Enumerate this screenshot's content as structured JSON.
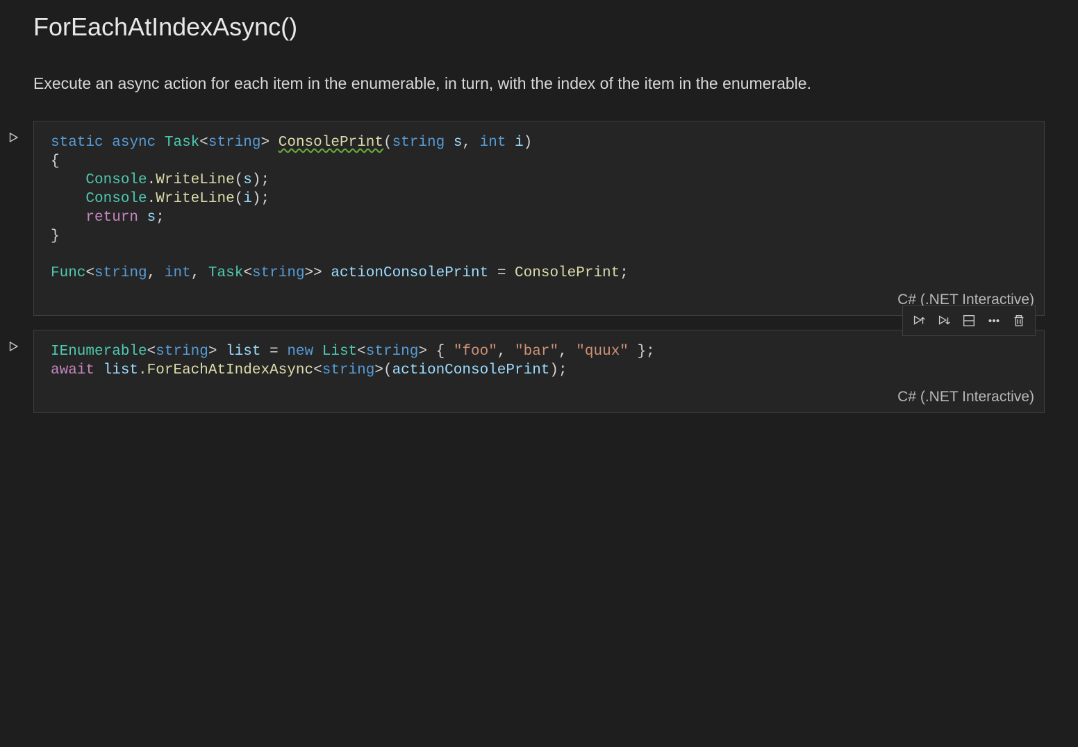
{
  "title": "ForEachAtIndexAsync()",
  "description": "Execute an async action for each item in the enumerable, in turn, with the index of the item in the enumerable.",
  "language_label": "C# (.NET Interactive)",
  "cells": [
    {
      "tokens": [
        [
          {
            "t": "static",
            "c": "kw"
          },
          {
            "t": " ",
            "c": "plain"
          },
          {
            "t": "async",
            "c": "kw"
          },
          {
            "t": " ",
            "c": "plain"
          },
          {
            "t": "Task",
            "c": "type"
          },
          {
            "t": "<",
            "c": "punct"
          },
          {
            "t": "string",
            "c": "kw"
          },
          {
            "t": "> ",
            "c": "punct"
          },
          {
            "t": "ConsolePrint",
            "c": "method-warn"
          },
          {
            "t": "(",
            "c": "punct"
          },
          {
            "t": "string",
            "c": "kw"
          },
          {
            "t": " ",
            "c": "plain"
          },
          {
            "t": "s",
            "c": "param"
          },
          {
            "t": ", ",
            "c": "punct"
          },
          {
            "t": "int",
            "c": "kw"
          },
          {
            "t": " ",
            "c": "plain"
          },
          {
            "t": "i",
            "c": "param"
          },
          {
            "t": ")",
            "c": "punct"
          }
        ],
        [
          {
            "t": "{",
            "c": "punct"
          }
        ],
        [
          {
            "t": "    ",
            "c": "plain"
          },
          {
            "t": "Console",
            "c": "type"
          },
          {
            "t": ".",
            "c": "punct"
          },
          {
            "t": "WriteLine",
            "c": "method"
          },
          {
            "t": "(",
            "c": "punct"
          },
          {
            "t": "s",
            "c": "var"
          },
          {
            "t": ");",
            "c": "punct"
          }
        ],
        [
          {
            "t": "    ",
            "c": "plain"
          },
          {
            "t": "Console",
            "c": "type"
          },
          {
            "t": ".",
            "c": "punct"
          },
          {
            "t": "WriteLine",
            "c": "method"
          },
          {
            "t": "(",
            "c": "punct"
          },
          {
            "t": "i",
            "c": "var"
          },
          {
            "t": ");",
            "c": "punct"
          }
        ],
        [
          {
            "t": "    ",
            "c": "plain"
          },
          {
            "t": "return",
            "c": "ctrl"
          },
          {
            "t": " ",
            "c": "plain"
          },
          {
            "t": "s",
            "c": "var"
          },
          {
            "t": ";",
            "c": "punct"
          }
        ],
        [
          {
            "t": "}",
            "c": "punct"
          }
        ],
        [],
        [
          {
            "t": "Func",
            "c": "type"
          },
          {
            "t": "<",
            "c": "punct"
          },
          {
            "t": "string",
            "c": "kw"
          },
          {
            "t": ", ",
            "c": "punct"
          },
          {
            "t": "int",
            "c": "kw"
          },
          {
            "t": ", ",
            "c": "punct"
          },
          {
            "t": "Task",
            "c": "type"
          },
          {
            "t": "<",
            "c": "punct"
          },
          {
            "t": "string",
            "c": "kw"
          },
          {
            "t": ">> ",
            "c": "punct"
          },
          {
            "t": "actionConsolePrint",
            "c": "var"
          },
          {
            "t": " = ",
            "c": "plain"
          },
          {
            "t": "ConsolePrint",
            "c": "method"
          },
          {
            "t": ";",
            "c": "punct"
          }
        ]
      ]
    },
    {
      "hasToolbar": true,
      "tokens": [
        [
          {
            "t": "IEnumerable",
            "c": "type"
          },
          {
            "t": "<",
            "c": "punct"
          },
          {
            "t": "string",
            "c": "kw"
          },
          {
            "t": "> ",
            "c": "punct"
          },
          {
            "t": "list",
            "c": "var"
          },
          {
            "t": " = ",
            "c": "plain"
          },
          {
            "t": "new",
            "c": "kw"
          },
          {
            "t": " ",
            "c": "plain"
          },
          {
            "t": "List",
            "c": "type"
          },
          {
            "t": "<",
            "c": "punct"
          },
          {
            "t": "string",
            "c": "kw"
          },
          {
            "t": "> { ",
            "c": "punct"
          },
          {
            "t": "\"foo\"",
            "c": "str"
          },
          {
            "t": ", ",
            "c": "punct"
          },
          {
            "t": "\"bar\"",
            "c": "str"
          },
          {
            "t": ", ",
            "c": "punct"
          },
          {
            "t": "\"quux\"",
            "c": "str"
          },
          {
            "t": " };",
            "c": "punct"
          }
        ],
        [
          {
            "t": "await",
            "c": "ctrl"
          },
          {
            "t": " ",
            "c": "plain"
          },
          {
            "t": "list",
            "c": "var"
          },
          {
            "t": ".",
            "c": "punct"
          },
          {
            "t": "ForEachAtIndexAsync",
            "c": "method"
          },
          {
            "t": "<",
            "c": "punct"
          },
          {
            "t": "string",
            "c": "kw"
          },
          {
            "t": ">(",
            "c": "punct"
          },
          {
            "t": "actionConsolePrint",
            "c": "var"
          },
          {
            "t": ");",
            "c": "punct"
          }
        ]
      ]
    }
  ],
  "toolbar_icons": [
    "execute-above-icon",
    "execute-below-icon",
    "split-cell-icon",
    "more-icon",
    "delete-icon"
  ]
}
